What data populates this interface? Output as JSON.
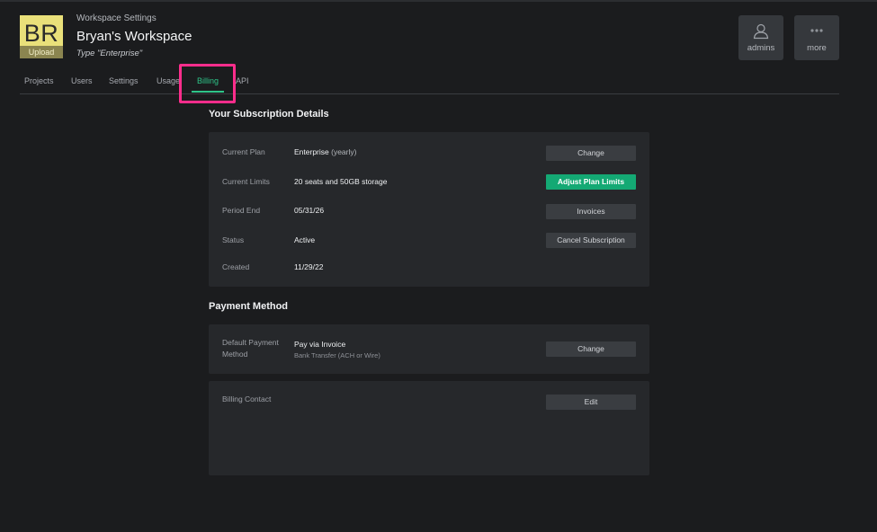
{
  "header": {
    "avatar_initials": "BR",
    "avatar_upload_label": "Upload",
    "kicker": "Workspace Settings",
    "workspace_name": "Bryan's Workspace",
    "workspace_type": "Type \"Enterprise\"",
    "buttons": [
      {
        "label": "admins",
        "icon": "person-icon"
      },
      {
        "label": "more",
        "icon": "ellipsis-icon"
      }
    ]
  },
  "tabs": [
    {
      "label": "Projects"
    },
    {
      "label": "Users"
    },
    {
      "label": "Settings"
    },
    {
      "label": "Usage"
    },
    {
      "label": "Billing",
      "active": true
    },
    {
      "label": "API"
    }
  ],
  "subscription": {
    "title": "Your Subscription Details",
    "rows": [
      {
        "label": "Current Plan",
        "value": "Enterprise",
        "value_sub": "(yearly)",
        "button": "Change"
      },
      {
        "label": "Current Limits",
        "value": "20 seats and 50GB storage",
        "button": "Adjust Plan Limits"
      },
      {
        "label": "Period End",
        "value": "05/31/26",
        "button": "Invoices"
      },
      {
        "label": "Status",
        "value": "Active",
        "button": "Cancel Subscription"
      },
      {
        "label": "Created",
        "value": "11/29/22"
      }
    ]
  },
  "payment": {
    "title": "Payment Method",
    "default_label": "Default Payment Method",
    "default_value": "Pay via Invoice",
    "default_sub": "Bank Transfer (ACH or Wire)",
    "default_button": "Change",
    "contact_label": "Billing Contact",
    "contact_button": "Edit"
  },
  "colors": {
    "accent": "#2ec488",
    "primary_button": "#14a974",
    "highlight": "#ff2d8c",
    "background": "#1b1c1e",
    "card": "#26282b"
  }
}
